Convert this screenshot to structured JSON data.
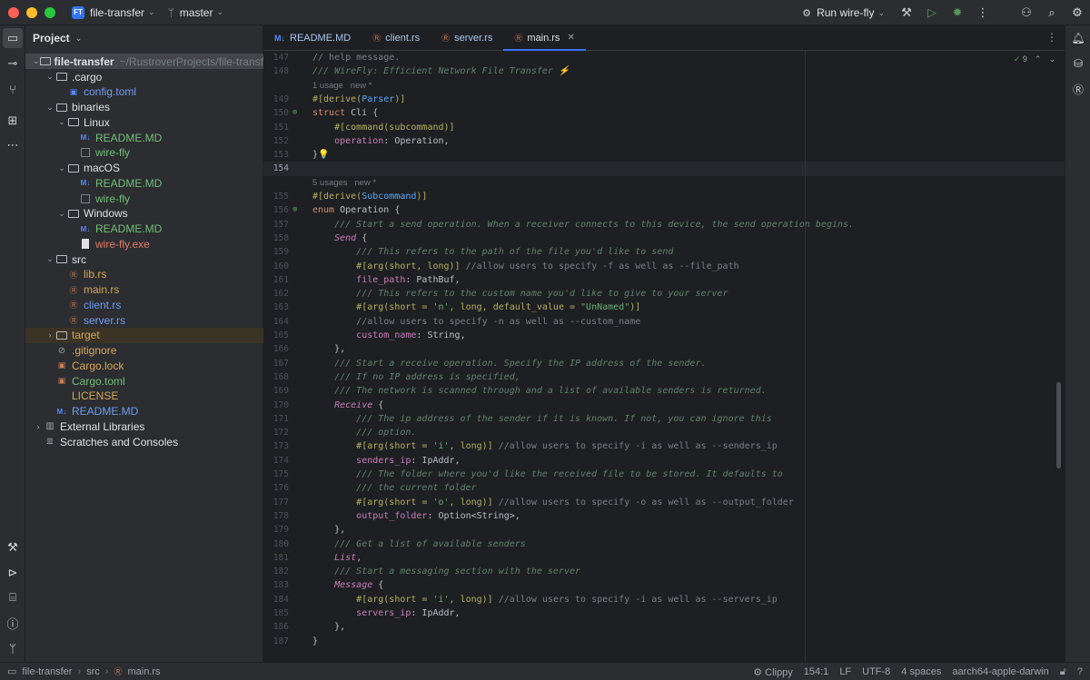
{
  "titlebar": {
    "project_badge": "FT",
    "project_name": "file-transfer",
    "branch_icon": "branch-icon",
    "branch": "master",
    "run_config": "Run wire-fly"
  },
  "project_panel": {
    "title": "Project",
    "root_name": "file-transfer",
    "root_path": "~/RustroverProjects/file-transfer",
    "items": [
      {
        "label": ".cargo",
        "depth": 1,
        "arrow": "open",
        "icon": "folder"
      },
      {
        "label": "config.toml",
        "depth": 2,
        "arrow": "",
        "icon": "toml",
        "color": "blue"
      },
      {
        "label": "binaries",
        "depth": 1,
        "arrow": "open",
        "icon": "folder"
      },
      {
        "label": "Linux",
        "depth": 2,
        "arrow": "open",
        "icon": "folder"
      },
      {
        "label": "README.MD",
        "depth": 3,
        "arrow": "",
        "icon": "md",
        "color": "green"
      },
      {
        "label": "wire-fly",
        "depth": 3,
        "arrow": "",
        "icon": "bin",
        "color": "green"
      },
      {
        "label": "macOS",
        "depth": 2,
        "arrow": "open",
        "icon": "folder"
      },
      {
        "label": "README.MD",
        "depth": 3,
        "arrow": "",
        "icon": "md",
        "color": "green"
      },
      {
        "label": "wire-fly",
        "depth": 3,
        "arrow": "",
        "icon": "bin",
        "color": "green"
      },
      {
        "label": "Windows",
        "depth": 2,
        "arrow": "open",
        "icon": "folder"
      },
      {
        "label": "README.MD",
        "depth": 3,
        "arrow": "",
        "icon": "md",
        "color": "green"
      },
      {
        "label": "wire-fly.exe",
        "depth": 3,
        "arrow": "",
        "icon": "file",
        "color": "red"
      },
      {
        "label": "src",
        "depth": 1,
        "arrow": "open",
        "icon": "folder"
      },
      {
        "label": "lib.rs",
        "depth": 2,
        "arrow": "",
        "icon": "rs",
        "color": "orange"
      },
      {
        "label": "main.rs",
        "depth": 2,
        "arrow": "",
        "icon": "rs",
        "color": "orange"
      },
      {
        "label": "client.rs",
        "depth": 2,
        "arrow": "",
        "icon": "rs",
        "color": "blue"
      },
      {
        "label": "server.rs",
        "depth": 2,
        "arrow": "",
        "icon": "rs",
        "color": "blue"
      },
      {
        "label": "target",
        "depth": 1,
        "arrow": "closed",
        "icon": "folder",
        "color": "orange",
        "excluded": true
      },
      {
        "label": ".gitignore",
        "depth": 1,
        "arrow": "",
        "icon": "git",
        "color": "orange"
      },
      {
        "label": "Cargo.lock",
        "depth": 1,
        "arrow": "",
        "icon": "cargo",
        "color": "orange"
      },
      {
        "label": "Cargo.toml",
        "depth": 1,
        "arrow": "",
        "icon": "cargo",
        "color": "green"
      },
      {
        "label": "LICENSE",
        "depth": 1,
        "arrow": "",
        "icon": "none",
        "color": "orange"
      },
      {
        "label": "README.MD",
        "depth": 1,
        "arrow": "",
        "icon": "md",
        "color": "blue"
      },
      {
        "label": "External Libraries",
        "depth": 0,
        "arrow": "closed",
        "icon": "lib"
      },
      {
        "label": "Scratches and Consoles",
        "depth": 0,
        "arrow": "",
        "icon": "scratch"
      }
    ]
  },
  "tabs": [
    {
      "label": "README.MD",
      "icon": "M↓",
      "active": false
    },
    {
      "label": "client.rs",
      "icon": "rs",
      "active": false
    },
    {
      "label": "server.rs",
      "icon": "rs",
      "active": false
    },
    {
      "label": "main.rs",
      "icon": "rs",
      "active": true
    }
  ],
  "inspections": {
    "count": "9"
  },
  "code_lines": [
    {
      "n": "147",
      "html": "<span class=\"cm\">// help message.</span>"
    },
    {
      "n": "148",
      "html": "<span class=\"doc\">/// WireFly: Efficient Network File Transfer ⚡</span>"
    },
    {
      "n": "",
      "hint": "1 usage   new *"
    },
    {
      "n": "149",
      "html": "<span class=\"attr\">#[derive(<span class=\"der\">Parser</span>)]</span>"
    },
    {
      "n": "150",
      "html": "<span class=\"k\">struct</span> Cli {",
      "gutter": true
    },
    {
      "n": "151",
      "html": "    <span class=\"attr\">#[command(subcommand)]</span>"
    },
    {
      "n": "152",
      "html": "    <span class=\"fld\">operation</span>: Operation,"
    },
    {
      "n": "153",
      "html": "}<span class=\"bulb\">💡</span>"
    },
    {
      "n": "154",
      "html": "",
      "current": true
    },
    {
      "n": "",
      "hint": "5 usages   new *"
    },
    {
      "n": "155",
      "html": "<span class=\"attr\">#[derive(<span class=\"der\">Subcommand</span>)]</span>"
    },
    {
      "n": "156",
      "html": "<span class=\"k\">enum</span> Operation {",
      "gutter": true
    },
    {
      "n": "157",
      "html": "    <span class=\"doc\">/// Start a send operation. When a receiver connects to this device, the send operation begins.</span>"
    },
    {
      "n": "158",
      "html": "    <span class=\"en\">Send</span> {"
    },
    {
      "n": "159",
      "html": "        <span class=\"doc\">/// This refers to the path of the file you'd like to send</span>"
    },
    {
      "n": "160",
      "html": "        <span class=\"attr\">#[arg(short, long)]</span> <span class=\"cm\">//allow users to specify -f as well as --file_path</span>"
    },
    {
      "n": "161",
      "html": "        <span class=\"fld\">file_path</span>: PathBuf,"
    },
    {
      "n": "162",
      "html": "        <span class=\"doc\">/// This refers to the custom name you'd like to give to your server</span>"
    },
    {
      "n": "163",
      "html": "        <span class=\"attr\">#[arg(short = <span class=\"str\">'n'</span>, long, default_value = <span class=\"str\">\"UnNamed\"</span>)]</span>"
    },
    {
      "n": "164",
      "html": "        <span class=\"cm\">//allow users to specify -n as well as --custom_name</span>"
    },
    {
      "n": "165",
      "html": "        <span class=\"fld\">custom_name</span>: String,"
    },
    {
      "n": "166",
      "html": "    },"
    },
    {
      "n": "167",
      "html": "    <span class=\"doc\">/// Start a receive operation. Specify the IP address of the sender.</span>"
    },
    {
      "n": "168",
      "html": "    <span class=\"doc\">/// If no IP address is specified,</span>"
    },
    {
      "n": "169",
      "html": "    <span class=\"doc\">/// The network is scanned through and a list of available senders is returned.</span>"
    },
    {
      "n": "170",
      "html": "    <span class=\"en\">Receive</span> {"
    },
    {
      "n": "171",
      "html": "        <span class=\"doc\">/// The ip address of the sender if it is known. If not, you can ignore this</span>"
    },
    {
      "n": "172",
      "html": "        <span class=\"doc\">/// option.</span>"
    },
    {
      "n": "173",
      "html": "        <span class=\"attr\">#[arg(short = <span class=\"str\">'i'</span>, long)]</span> <span class=\"cm\">//allow users to specify -i as well as --senders_ip</span>"
    },
    {
      "n": "174",
      "html": "        <span class=\"fld\">senders_ip</span>: IpAddr,"
    },
    {
      "n": "175",
      "html": "        <span class=\"doc\">/// The folder where you'd like the received file to be stored. It defaults to</span>"
    },
    {
      "n": "176",
      "html": "        <span class=\"doc\">/// the current folder</span>"
    },
    {
      "n": "177",
      "html": "        <span class=\"attr\">#[arg(short = <span class=\"str\">'o'</span>, long)]</span> <span class=\"cm\">//allow users to specify -o as well as --output_folder</span>"
    },
    {
      "n": "178",
      "html": "        <span class=\"fld\">output_folder</span>: Option&lt;String&gt;,"
    },
    {
      "n": "179",
      "html": "    },"
    },
    {
      "n": "180",
      "html": "    <span class=\"doc\">/// Get a list of available senders</span>"
    },
    {
      "n": "181",
      "html": "    <span class=\"en\">List</span>,"
    },
    {
      "n": "182",
      "html": "    <span class=\"doc\">/// Start a messaging section with the server</span>"
    },
    {
      "n": "183",
      "html": "    <span class=\"en\">Message</span> {"
    },
    {
      "n": "184",
      "html": "        <span class=\"attr\">#[arg(short = <span class=\"str\">'i'</span>, long)]</span> <span class=\"cm\">//allow users to specify -i as well as --servers_ip</span>"
    },
    {
      "n": "185",
      "html": "        <span class=\"fld\">servers_ip</span>: IpAddr,"
    },
    {
      "n": "186",
      "html": "    },"
    },
    {
      "n": "187",
      "html": "}"
    }
  ],
  "status": {
    "crumbs": [
      "file-transfer",
      "src",
      "main.rs"
    ],
    "clippy": "Clippy",
    "position": "154:1",
    "line_sep": "LF",
    "encoding": "UTF-8",
    "indent": "4 spaces",
    "target": "aarch64-apple-darwin"
  }
}
